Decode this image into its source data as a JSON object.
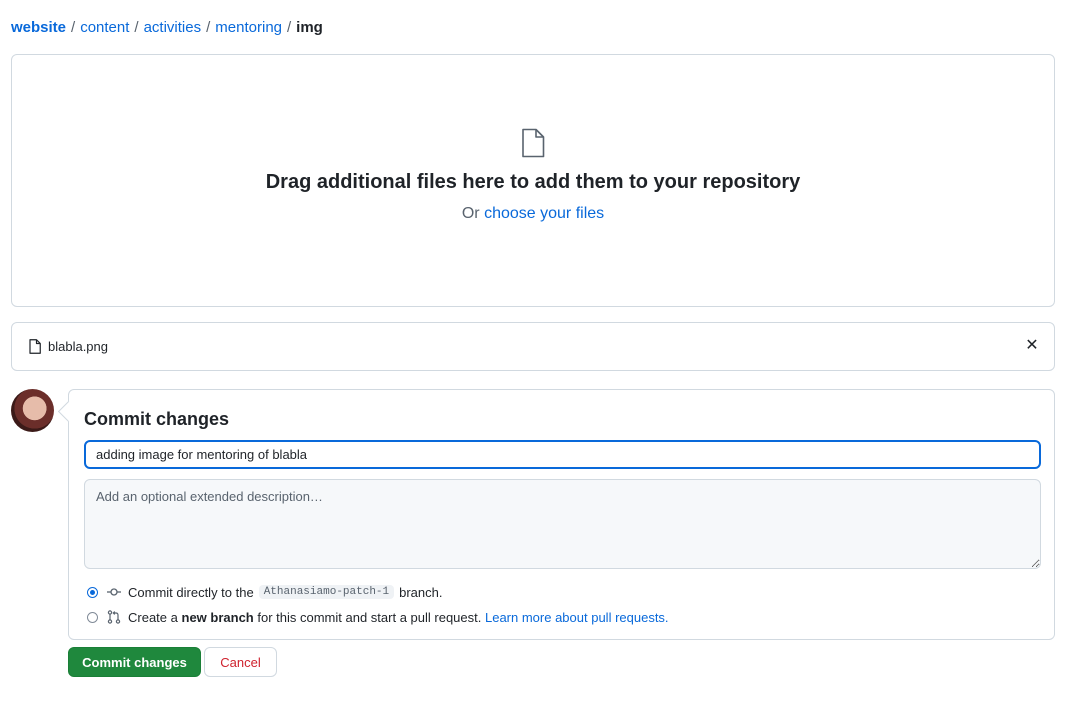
{
  "breadcrumb": {
    "repo": "website",
    "path": [
      "content",
      "activities",
      "mentoring"
    ],
    "current": "img",
    "separator": "/"
  },
  "dropzone": {
    "title": "Drag additional files here to add them to your repository",
    "or_text": "Or",
    "choose_link": "choose your files",
    "icon": "file-icon"
  },
  "uploaded_file": {
    "name": "blabla.png",
    "icon": "file-icon",
    "remove_icon": "x-icon",
    "remove_glyph": "✕"
  },
  "commit": {
    "heading": "Commit changes",
    "summary_value": "adding image for mentoring of blabla",
    "description_placeholder": "Add an optional extended description…",
    "options": {
      "direct": {
        "prefix": "Commit directly to the",
        "branch": "Athanasiamo-patch-1",
        "suffix": "branch.",
        "selected": true,
        "icon": "git-commit-icon"
      },
      "new_branch": {
        "prefix": "Create a",
        "bold": "new branch",
        "middle": "for this commit and start a pull request.",
        "link": "Learn more about pull requests.",
        "selected": false,
        "icon": "git-pull-request-icon"
      }
    },
    "submit_label": "Commit changes",
    "cancel_label": "Cancel"
  },
  "colors": {
    "link": "#0969da",
    "primary_button": "#1f883d",
    "danger_text": "#cf222e",
    "border": "#d1d9e0"
  }
}
